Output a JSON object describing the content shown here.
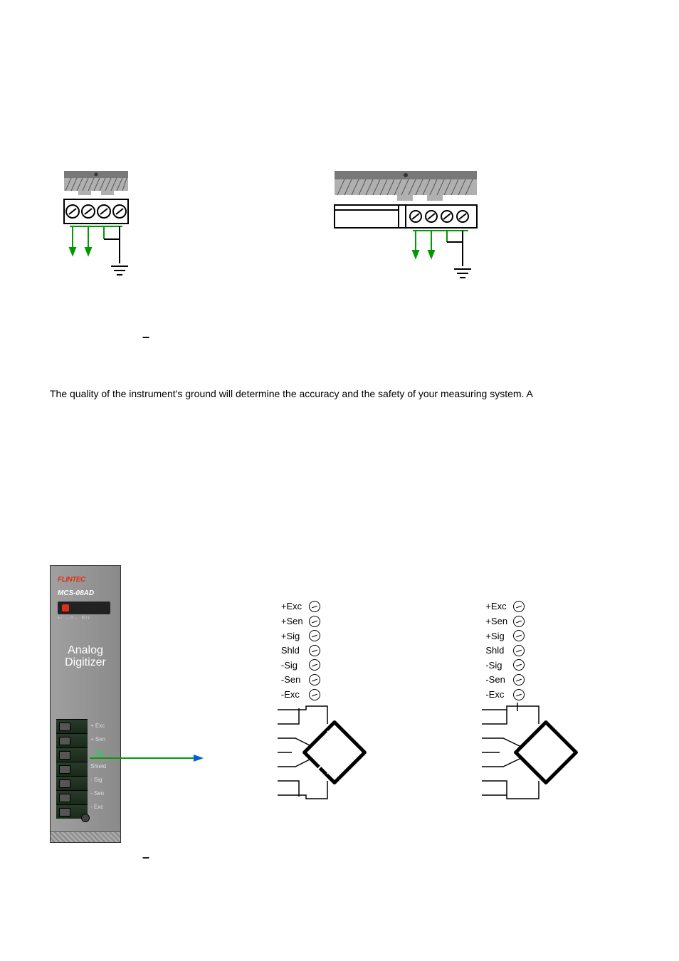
{
  "top_text": "The quality of the instrument's ground will determine the accuracy and the safety of your measuring system. A",
  "mod": {
    "brand": "FLINTEC",
    "model": "MCS-08AD",
    "leds": "▪▫  →0← Err",
    "big1": "Analog",
    "big2": "Digitizer",
    "term_labels": [
      "+ Exc",
      "+ Sen",
      "+ Sig",
      "Shield",
      "- Sig",
      "- Sen",
      "- Exc"
    ]
  },
  "pins": [
    "+Exc",
    "+Sen",
    "+Sig",
    "Shld",
    "-Sig",
    "-Sen",
    "-Exc"
  ],
  "dash": "–"
}
